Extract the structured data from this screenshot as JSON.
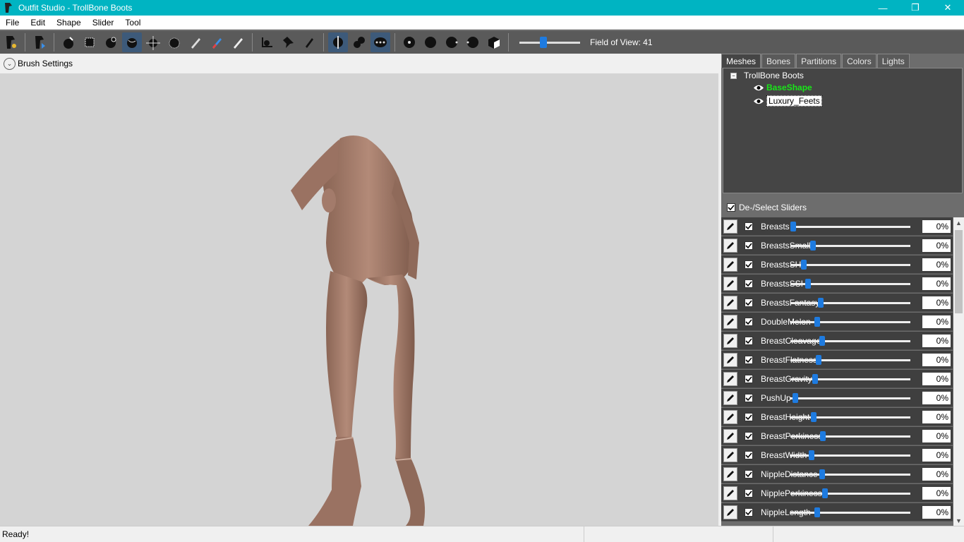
{
  "window": {
    "title": "Outfit Studio - TrollBone Boots",
    "minimize": "—",
    "maximize": "❐",
    "close": "✕"
  },
  "menu": [
    "File",
    "Edit",
    "Shape",
    "Slider",
    "Tool"
  ],
  "toolbar": {
    "fov_label": "Field of View: 41",
    "fov_value": 41
  },
  "brush_settings": {
    "label": "Brush Settings"
  },
  "tabs": [
    {
      "label": "Meshes",
      "active": true
    },
    {
      "label": "Bones",
      "active": false
    },
    {
      "label": "Partitions",
      "active": false
    },
    {
      "label": "Colors",
      "active": false
    },
    {
      "label": "Lights",
      "active": false
    }
  ],
  "mesh_tree": {
    "root": "TrollBone Boots",
    "items": [
      "BaseShape",
      "Luxury_Feets"
    ]
  },
  "deselect_label": "De-/Select Sliders",
  "sliders": [
    {
      "name": "Breasts",
      "value": "0%",
      "pos": 0.0
    },
    {
      "name": "BreastsSmall",
      "value": "0%",
      "pos": 0.17
    },
    {
      "name": "BreastsSH",
      "value": "0%",
      "pos": 0.09
    },
    {
      "name": "BreastsSSH",
      "value": "0%",
      "pos": 0.13
    },
    {
      "name": "BreastsFantasy",
      "value": "0%",
      "pos": 0.24
    },
    {
      "name": "DoubleMelon",
      "value": "0%",
      "pos": 0.21
    },
    {
      "name": "BreastCleavage",
      "value": "0%",
      "pos": 0.25
    },
    {
      "name": "BreastFlatness",
      "value": "0%",
      "pos": 0.22
    },
    {
      "name": "BreastGravity",
      "value": "0%",
      "pos": 0.19
    },
    {
      "name": "PushUp",
      "value": "0%",
      "pos": 0.02
    },
    {
      "name": "BreastHeight",
      "value": "0%",
      "pos": 0.18
    },
    {
      "name": "BreastPerkiness",
      "value": "0%",
      "pos": 0.26
    },
    {
      "name": "BreastWidth",
      "value": "0%",
      "pos": 0.16
    },
    {
      "name": "NippleDistance",
      "value": "0%",
      "pos": 0.25
    },
    {
      "name": "NipplePerkiness",
      "value": "0%",
      "pos": 0.28
    },
    {
      "name": "NippleLength",
      "value": "0%",
      "pos": 0.21
    }
  ],
  "status": {
    "text": "Ready!"
  },
  "colors": {
    "accent": "#00b4c2",
    "slider_thumb": "#1e7be0",
    "baseshape": "#19e619"
  }
}
